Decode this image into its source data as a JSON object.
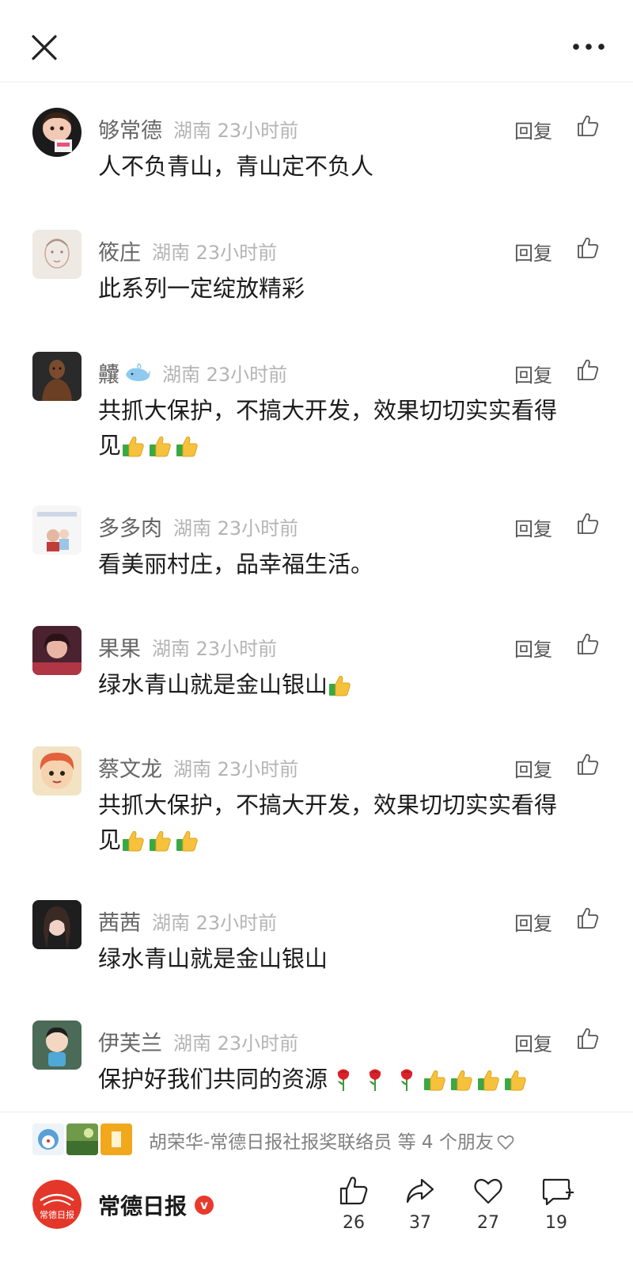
{
  "header": {
    "close_icon": "close-icon",
    "more_icon": "more-icon"
  },
  "comment_common": {
    "reply_label": "回复",
    "location": "湖南",
    "time": "23小时前"
  },
  "comments": [
    {
      "user": "够常德",
      "text": "人不负青山，青山定不负人"
    },
    {
      "user": "筱庄",
      "text": "此系列一定绽放精彩"
    },
    {
      "user": "齉",
      "text_line1": "共抓大保护，不搞大开发，效果切切实实看得",
      "text_line2": "见"
    },
    {
      "user": "多多肉",
      "text": "看美丽村庄，品幸福生活。"
    },
    {
      "user": "果果",
      "text": "绿水青山就是金山银山"
    },
    {
      "user": "蔡文龙",
      "text_line1": "共抓大保护，不搞大开发，效果切切实实看得",
      "text_line2": "见"
    },
    {
      "user": "茜茜",
      "text": "绿水青山就是金山银山"
    },
    {
      "user": "伊芙兰",
      "text": "保护好我们共同的资源"
    }
  ],
  "friends": {
    "text": "胡荣华-常德日报社报奖联络员 等 4 个朋友"
  },
  "footer": {
    "account_name": "常德日报",
    "logo_text": "常德日报",
    "verified_mark": "v",
    "like_count": "26",
    "share_count": "37",
    "favorite_count": "27",
    "comment_count": "19"
  },
  "colors": {
    "accent": "#e83a2b",
    "muted": "#b4b4b4"
  }
}
